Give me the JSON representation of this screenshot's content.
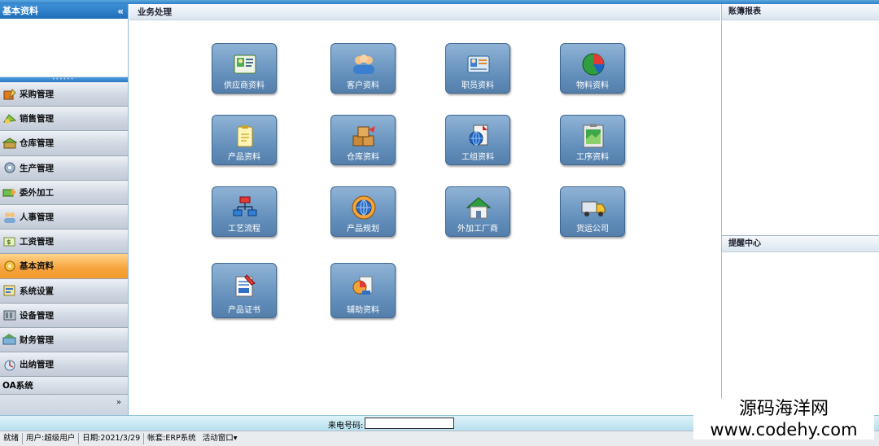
{
  "sidebar": {
    "title": "基本资料",
    "collapse_glyph": "«",
    "items": [
      {
        "label": "采购管理",
        "icon": "purchase-icon"
      },
      {
        "label": "销售管理",
        "icon": "sales-icon"
      },
      {
        "label": "仓库管理",
        "icon": "warehouse-icon"
      },
      {
        "label": "生产管理",
        "icon": "production-icon"
      },
      {
        "label": "委外加工",
        "icon": "outsource-icon"
      },
      {
        "label": "人事管理",
        "icon": "personnel-icon"
      },
      {
        "label": "工资管理",
        "icon": "salary-icon"
      },
      {
        "label": "基本资料",
        "icon": "basic-data-icon",
        "active": true
      },
      {
        "label": "系统设置",
        "icon": "system-settings-icon"
      },
      {
        "label": "设备管理",
        "icon": "equipment-icon"
      },
      {
        "label": "财务管理",
        "icon": "finance-icon"
      },
      {
        "label": "出纳管理",
        "icon": "cashier-icon"
      }
    ],
    "oa_label": "OA系统",
    "more_glyph": "»"
  },
  "main": {
    "title": "业务处理",
    "tiles": [
      {
        "label": "供应商资料",
        "icon": "supplier-card-icon"
      },
      {
        "label": "客户资料",
        "icon": "customers-icon"
      },
      {
        "label": "职员资料",
        "icon": "staff-card-icon"
      },
      {
        "label": "物料资料",
        "icon": "pie-chart-icon"
      },
      {
        "label": "产品资料",
        "icon": "product-clipboard-icon"
      },
      {
        "label": "仓库资料",
        "icon": "boxes-icon"
      },
      {
        "label": "工组资料",
        "icon": "globe-document-icon"
      },
      {
        "label": "工序资料",
        "icon": "process-board-icon"
      },
      {
        "label": "工艺流程",
        "icon": "flowchart-icon"
      },
      {
        "label": "产品规划",
        "icon": "gear-globe-icon"
      },
      {
        "label": "外加工厂商",
        "icon": "house-icon"
      },
      {
        "label": "货运公司",
        "icon": "truck-icon"
      },
      {
        "label": "产品证书",
        "icon": "certificate-icon"
      },
      {
        "label": "辅助资料",
        "icon": "chart-box-icon"
      }
    ]
  },
  "right": {
    "report_title": "账簿报表",
    "reminder_title": "提醒中心"
  },
  "status": {
    "phone_label": "来电号码:",
    "phone_value": "",
    "ready": "就绪",
    "user": "用户:超级用户",
    "date": "日期:2021/3/29",
    "account": "帐套:ERP系统",
    "active_window": "活动窗口",
    "dropdown_glyph": "▾"
  },
  "watermark": {
    "line1": "源码海洋网",
    "line2": "www.codehy.com"
  },
  "colors": {
    "header_blue": "#1f6fb8",
    "active_orange": "#f6a33c",
    "tile_blue": "#6f98c2",
    "status_cyan": "#c3e7f2"
  }
}
